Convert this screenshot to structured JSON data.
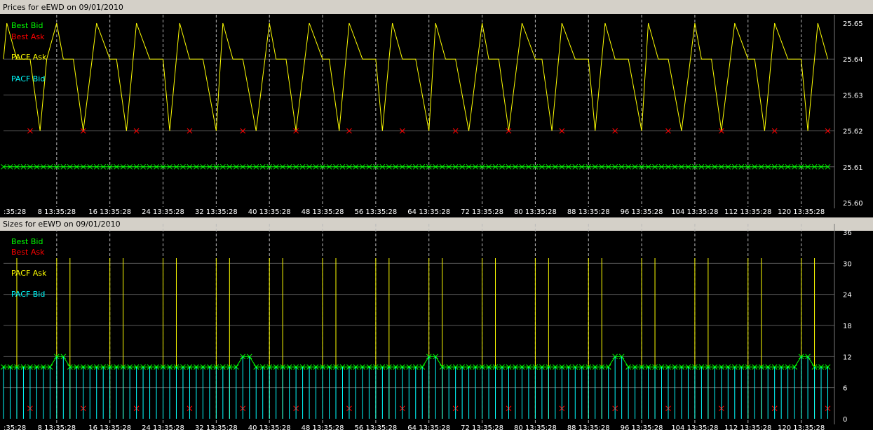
{
  "colors": {
    "best_bid": "#00ff00",
    "best_ask": "#ff0000",
    "pacf_ask": "#ffff00",
    "pacf_bid": "#00ffff",
    "panel_bg": "#000000",
    "chrome": "#d4d0c8",
    "grid": "#5a5a5a"
  },
  "chart_data": [
    {
      "type": "line",
      "title": "Prices for  eEWD  on  09/01/2010",
      "x_tick_labels": [
        ":35:28",
        "8 13:35:28",
        "16 13:35:28",
        "24 13:35:28",
        "32 13:35:28",
        "40 13:35:28",
        "48 13:35:28",
        "56 13:35:28",
        "64 13:35:28",
        "72 13:35:28",
        "80 13:35:28",
        "88 13:35:28",
        "96 13:35:28",
        "104 13:35:28",
        "112 13:35:28",
        "120 13:35:28"
      ],
      "y_tick_labels": [
        "25.65",
        "25.64",
        "25.63",
        "25.62",
        "25.61",
        "25.60"
      ],
      "ylim": [
        25.6,
        25.65
      ],
      "xlim": [
        0,
        125
      ],
      "legend": [
        "Best Bid",
        "Best Ask",
        "PACF Ask",
        "PACF Bid"
      ],
      "legend_position": "top-left",
      "grid": true,
      "series": [
        {
          "name": "PACF Ask",
          "x": [
            0,
            0.5,
            2,
            4,
            5.5,
            6.5,
            8,
            9,
            10.5,
            12,
            14,
            16,
            17,
            18.5,
            20,
            22,
            24,
            25,
            26.5,
            28,
            30,
            32,
            33,
            34.5,
            36,
            38,
            40,
            41,
            42.5,
            44,
            46,
            48,
            49,
            50.5,
            52,
            54,
            56,
            57,
            58.5,
            60,
            62,
            64,
            65,
            66.5,
            68,
            70,
            72,
            73,
            74.5,
            76,
            78,
            80,
            81,
            82.5,
            84,
            86,
            88,
            89,
            90.5,
            92,
            94,
            96,
            97,
            98.5,
            100,
            102,
            104,
            105,
            106.5,
            108,
            110,
            112,
            113,
            114.5,
            116,
            118,
            120,
            121,
            122.5,
            124
          ],
          "y": [
            25.64,
            25.65,
            25.64,
            25.64,
            25.62,
            25.64,
            25.65,
            25.64,
            25.64,
            25.62,
            25.65,
            25.64,
            25.64,
            25.62,
            25.65,
            25.64,
            25.64,
            25.62,
            25.65,
            25.64,
            25.64,
            25.62,
            25.65,
            25.64,
            25.64,
            25.62,
            25.65,
            25.64,
            25.64,
            25.62,
            25.65,
            25.64,
            25.64,
            25.62,
            25.65,
            25.64,
            25.64,
            25.62,
            25.65,
            25.64,
            25.64,
            25.62,
            25.65,
            25.64,
            25.64,
            25.62,
            25.65,
            25.64,
            25.64,
            25.62,
            25.65,
            25.64,
            25.64,
            25.62,
            25.65,
            25.64,
            25.64,
            25.62,
            25.65,
            25.64,
            25.64,
            25.62,
            25.65,
            25.64,
            25.64,
            25.62,
            25.65,
            25.64,
            25.64,
            25.62,
            25.65,
            25.64,
            25.64,
            25.62,
            25.65,
            25.64,
            25.64,
            25.62,
            25.65,
            25.64
          ]
        },
        {
          "name": "Best Ask",
          "x": [
            4,
            12,
            20,
            28,
            36,
            44,
            52,
            60,
            68,
            76,
            84,
            92,
            100,
            108,
            116,
            124
          ],
          "y": [
            25.62,
            25.62,
            25.62,
            25.62,
            25.62,
            25.62,
            25.62,
            25.62,
            25.62,
            25.62,
            25.62,
            25.62,
            25.62,
            25.62,
            25.62,
            25.62
          ]
        },
        {
          "name": "Best Bid",
          "constant_y": 25.61,
          "x_start": 0,
          "x_end": 124,
          "x_step": 1
        }
      ]
    },
    {
      "type": "bar",
      "title": "Sizes for  eEWD  on  09/01/2010",
      "x_tick_labels": [
        ":35:28",
        "8 13:35:28",
        "16 13:35:28",
        "24 13:35:28",
        "32 13:35:28",
        "40 13:35:28",
        "48 13:35:28",
        "56 13:35:28",
        "64 13:35:28",
        "72 13:35:28",
        "80 13:35:28",
        "88 13:35:28",
        "96 13:35:28",
        "104 13:35:28",
        "112 13:35:28",
        "120 13:35:28"
      ],
      "y_tick_labels": [
        "36",
        "30",
        "24",
        "18",
        "12",
        "6",
        "0"
      ],
      "ylim": [
        0,
        36
      ],
      "xlim": [
        0,
        125
      ],
      "legend": [
        "Best Bid",
        "Best Ask",
        "PACF Ask",
        "PACF Bid"
      ],
      "legend_position": "top-left",
      "grid": true,
      "series": [
        {
          "name": "PACF Ask",
          "x": [
            2,
            8,
            10,
            16,
            18,
            24,
            26,
            32,
            34,
            40,
            42,
            48,
            50,
            56,
            58,
            64,
            66,
            72,
            74,
            80,
            82,
            88,
            90,
            96,
            98,
            104,
            106,
            112,
            114,
            120,
            122
          ],
          "y": [
            31,
            31,
            31,
            31,
            31,
            31,
            31,
            31,
            31,
            31,
            31,
            31,
            31,
            31,
            31,
            31,
            31,
            31,
            31,
            31,
            31,
            31,
            31,
            31,
            31,
            31,
            31,
            31,
            31,
            31,
            31
          ]
        },
        {
          "name": "Best Ask",
          "x": [
            4,
            12,
            20,
            28,
            36,
            44,
            52,
            60,
            68,
            76,
            84,
            92,
            100,
            108,
            116,
            124
          ],
          "y": [
            2,
            2,
            2,
            2,
            2,
            2,
            2,
            2,
            2,
            2,
            2,
            2,
            2,
            2,
            2,
            2
          ]
        },
        {
          "name": "Best Bid",
          "x_start": 0,
          "x_end": 124,
          "x_step": 1,
          "default_y": 10,
          "peaks": [
            {
              "x": 8,
              "y": 12
            },
            {
              "x": 9,
              "y": 12
            },
            {
              "x": 36,
              "y": 12
            },
            {
              "x": 37,
              "y": 12
            },
            {
              "x": 64,
              "y": 12
            },
            {
              "x": 65,
              "y": 12
            },
            {
              "x": 92,
              "y": 12
            },
            {
              "x": 93,
              "y": 12
            },
            {
              "x": 120,
              "y": 12
            },
            {
              "x": 121,
              "y": 12
            }
          ]
        },
        {
          "name": "PACF Bid",
          "x_start": 0,
          "x_end": 124,
          "x_step": 1,
          "default_y": 10,
          "peaks": [
            {
              "x": 8,
              "y": 12
            },
            {
              "x": 9,
              "y": 12
            },
            {
              "x": 36,
              "y": 12
            },
            {
              "x": 37,
              "y": 12
            },
            {
              "x": 64,
              "y": 12
            },
            {
              "x": 65,
              "y": 12
            },
            {
              "x": 92,
              "y": 12
            },
            {
              "x": 93,
              "y": 12
            },
            {
              "x": 120,
              "y": 12
            },
            {
              "x": 121,
              "y": 12
            }
          ]
        }
      ]
    }
  ]
}
